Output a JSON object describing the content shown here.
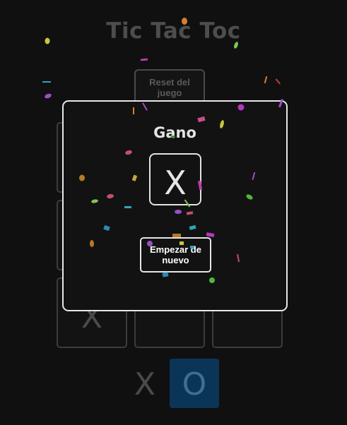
{
  "game": {
    "title": "Tic Tac Toc",
    "reset_label": "Reset del juego",
    "board": [
      "",
      "",
      "",
      "",
      "",
      "",
      "X",
      "",
      ""
    ],
    "turn_x": "X",
    "turn_o": "O",
    "active_turn": "O"
  },
  "modal": {
    "title": "Gano",
    "winner": "X",
    "restart_label": "Empezar de nuevo"
  },
  "colors": {
    "background": "#101010",
    "modal_border": "#e8e8e8",
    "active_turn_bg": "#0b3557"
  }
}
